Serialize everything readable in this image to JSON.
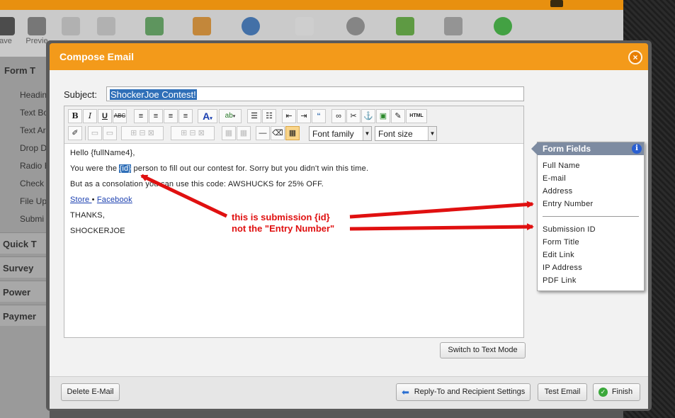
{
  "toolbar": {
    "save_label": "ave",
    "preview_label": "Previe"
  },
  "left_panel": {
    "form_tools_label": "Form T",
    "items": [
      "Headin",
      "Text Bo",
      "Text Ar",
      "Drop D",
      "Radio B",
      "Check",
      "File Up",
      "Submi"
    ],
    "sections": [
      "Quick T",
      "Survey",
      "Power",
      "Paymer"
    ]
  },
  "modal": {
    "title": "Compose Email",
    "close_glyph": "×",
    "subject_label": "Subject:",
    "subject_value": "ShockerJoe Contest!",
    "toolbar": {
      "font_family": "Font family",
      "font_size": "Font size"
    },
    "body": {
      "line1": "Hello {fullName4},",
      "line2_pre": "You were the ",
      "line2_sel": "{id}",
      "line2_post": " person to fill out our contest for. Sorry but you didn't win this time.",
      "line3": "But as a consolation you can use this code: AWSHUCKS for 25% OFF.",
      "link_store": "Store ",
      "bullet": "•",
      "link_facebook": "Facebook",
      "line5": "THANKS,",
      "line6": "SHOCKERJOE"
    },
    "switch_mode_label": "Switch to Text Mode",
    "footer": {
      "delete_label": "Delete E-Mail",
      "reply_to_label": "Reply-To and Recipient Settings",
      "test_email_label": "Test Email",
      "finish_label": "Finish"
    }
  },
  "form_fields": {
    "title": "Form Fields",
    "info_glyph": "i",
    "group1": [
      "Full Name",
      "E-mail",
      "Address",
      "Entry Number"
    ],
    "group2": [
      "Submission ID",
      "Form Title",
      "Edit Link",
      "IP Address",
      "PDF Link"
    ]
  },
  "annotation": {
    "line1": "this is submission {id}",
    "line2": "not the \"Entry Number\"",
    "color": "#e01010"
  },
  "colors": {
    "header": "#f39a1a",
    "selection": "#2f6fb8",
    "panel_header": "#7d8ba1"
  }
}
